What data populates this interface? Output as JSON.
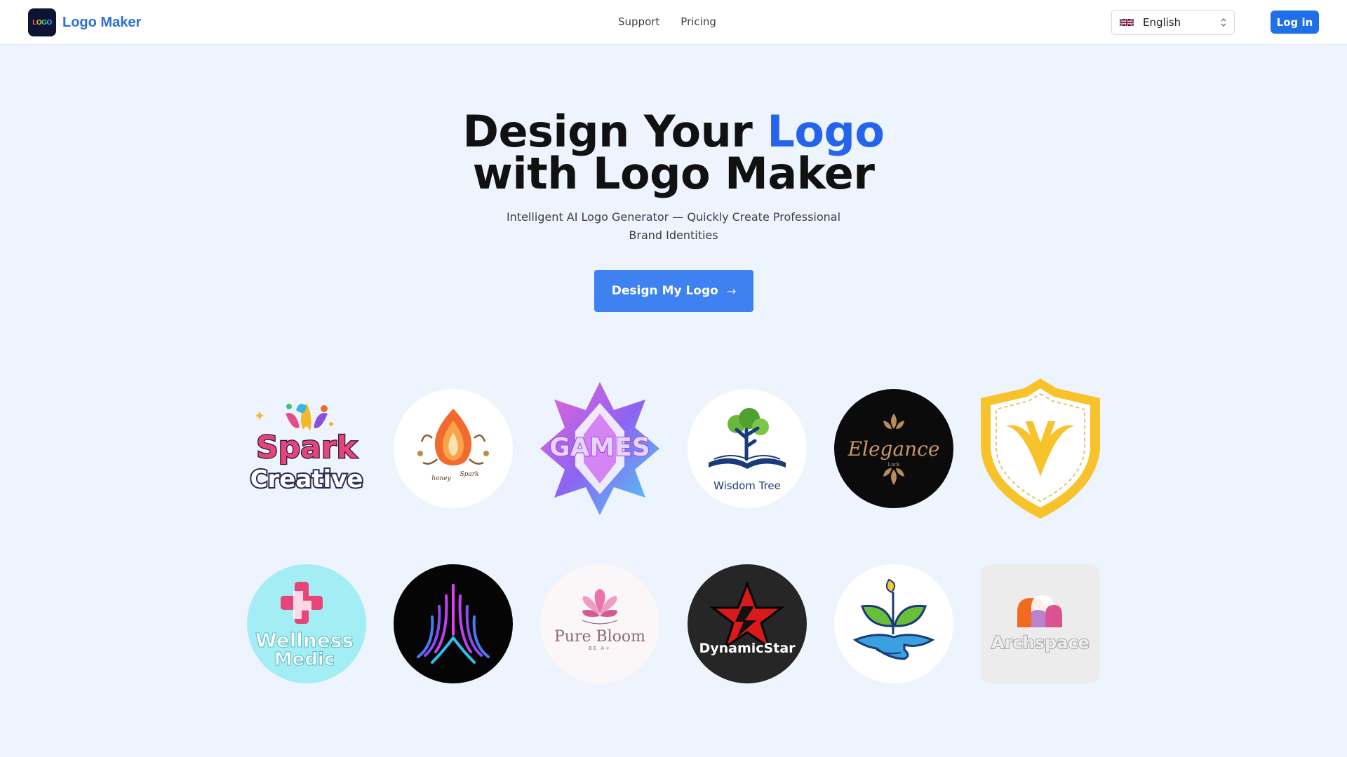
{
  "header": {
    "brand_name": "Logo Maker",
    "brand_mark_letters": [
      "L",
      "O",
      "G",
      "O"
    ],
    "nav": [
      {
        "label": "Support"
      },
      {
        "label": "Pricing"
      }
    ],
    "language": {
      "selected": "English",
      "flag": "uk-flag-icon"
    },
    "login_label": "Log in"
  },
  "hero": {
    "title_part1": "Design Your ",
    "title_accent": "Logo",
    "title_line2": "with Logo Maker",
    "subtitle": "Intelligent AI Logo Generator — Quickly Create Professional Brand Identities",
    "cta_label": "Design My Logo",
    "cta_icon": "→"
  },
  "logos": {
    "row1": [
      {
        "name": "spark-creative",
        "text1": "Spark",
        "text2": "Creative"
      },
      {
        "name": "flame-ornament",
        "text1": "honey",
        "text2": "Spark"
      },
      {
        "name": "games",
        "text1": "GAMES"
      },
      {
        "name": "wisdom-tree",
        "text1": "Wisdom Tree"
      },
      {
        "name": "elegance",
        "text1": "Elegance",
        "text2": "Luck"
      },
      {
        "name": "v-shield",
        "text1": "V"
      }
    ],
    "row2": [
      {
        "name": "wellness-medic",
        "text1": "Wellness",
        "text2": "Medic"
      },
      {
        "name": "neon-waves",
        "text1": ""
      },
      {
        "name": "pure-bloom",
        "text1": "Pure Bloom",
        "text2": "BE A+"
      },
      {
        "name": "dynamic-star",
        "text1": "DynamicStar"
      },
      {
        "name": "plant-hand",
        "text1": ""
      },
      {
        "name": "archspace",
        "text1": "Archspace"
      }
    ]
  },
  "colors": {
    "accent": "#2563eb",
    "brand": "#2a6fdc",
    "login_bg": "#1f6fe8",
    "cta_bg": "#3d82f0",
    "page_bg": "#eef4fd"
  }
}
